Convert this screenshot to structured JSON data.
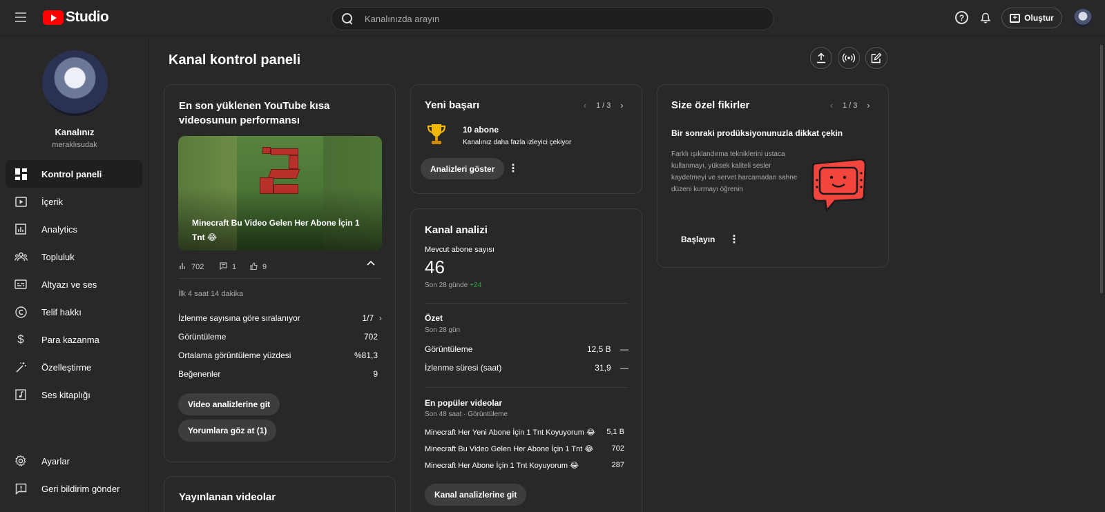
{
  "app": {
    "logo_text": "Studio",
    "search_placeholder": "Kanalınızda arayın",
    "create_label": "Oluştur"
  },
  "sidebar": {
    "channel_name": "Kanalınız",
    "channel_handle": "meraklısudak",
    "items": [
      {
        "label": "Kontrol paneli",
        "icon": "dashboard-icon",
        "active": true
      },
      {
        "label": "İçerik",
        "icon": "content-icon"
      },
      {
        "label": "Analytics",
        "icon": "analytics-icon"
      },
      {
        "label": "Topluluk",
        "icon": "community-icon"
      },
      {
        "label": "Altyazı ve ses",
        "icon": "subtitles-icon"
      },
      {
        "label": "Telif hakkı",
        "icon": "copyright-icon"
      },
      {
        "label": "Para kazanma",
        "icon": "dollar-icon"
      },
      {
        "label": "Özelleştirme",
        "icon": "magic-wand-icon"
      },
      {
        "label": "Ses kitaplığı",
        "icon": "audio-library-icon"
      }
    ],
    "bottom_items": [
      {
        "label": "Ayarlar",
        "icon": "gear-icon"
      },
      {
        "label": "Geri bildirim gönder",
        "icon": "feedback-icon"
      }
    ]
  },
  "main": {
    "page_title": "Kanal kontrol paneli",
    "short_card": {
      "title": "En son yüklenen YouTube kısa videosunun performansı",
      "video_title": "Minecraft Bu Video Gelen Her Abone İçin 1 Tnt 😂",
      "views": "702",
      "comments": "1",
      "likes": "9",
      "period": "İlk 4 saat 14 dakika",
      "rank_label": "İzlenme sayısına göre sıralanıyor",
      "rank_value": "1/7",
      "rows": [
        {
          "label": "Görüntüleme",
          "value": "702"
        },
        {
          "label": "Ortalama görüntüleme yüzdesi",
          "value": "%81,3"
        },
        {
          "label": "Beğenenler",
          "value": "9"
        }
      ],
      "btn_analytics": "Video analizlerine git",
      "btn_comments": "Yorumlara göz at (1)"
    },
    "published_card": {
      "title": "Yayınlanan videolar"
    },
    "achievement_card": {
      "title": "Yeni başarı",
      "pager": "1 / 3",
      "headline": "10 abone",
      "subtext": "Kanalınız daha fazla izleyici çekiyor",
      "button": "Analizleri göster"
    },
    "analytics_card": {
      "title": "Kanal analizi",
      "subs_label": "Mevcut abone sayısı",
      "subs_value": "46",
      "subs_period": "Son 28 günde",
      "subs_delta": "+24",
      "summary_title": "Özet",
      "summary_period": "Son 28 gün",
      "summary_rows": [
        {
          "label": "Görüntüleme",
          "value": "12,5 B",
          "trend": "—"
        },
        {
          "label": "İzlenme süresi (saat)",
          "value": "31,9",
          "trend": "—"
        }
      ],
      "top_title": "En popüler videolar",
      "top_period": "Son 48 saat · Görüntüleme",
      "top_videos": [
        {
          "title": "Minecraft Her Yeni Abone İçin 1 Tnt Koyuyorum 😂",
          "value": "5,1 B"
        },
        {
          "title": "Minecraft Bu Video Gelen Her Abone İçin 1 Tnt 😂",
          "value": "702"
        },
        {
          "title": "Minecraft Her Abone İçin 1 Tnt Koyuyorum 😂",
          "value": "287"
        }
      ],
      "button": "Kanal analizlerine git"
    },
    "ideas_card": {
      "title": "Size özel fikirler",
      "pager": "1 / 3",
      "headline": "Bir sonraki prodüksiyonunuzla dikkat çekin",
      "body": "Farklı ışıklandırma tekniklerini ustaca kullanmayı, yüksek kaliteli sesler kaydetmeyi ve servet harcamadan sahne düzeni kurmayı öğrenin",
      "button": "Başlayın"
    }
  },
  "colors": {
    "background": "#282828",
    "card_border": "#3a3a3a",
    "brand_red": "#ff0000",
    "positive_green": "#2ba640",
    "illustration_red": "#f2453d"
  }
}
